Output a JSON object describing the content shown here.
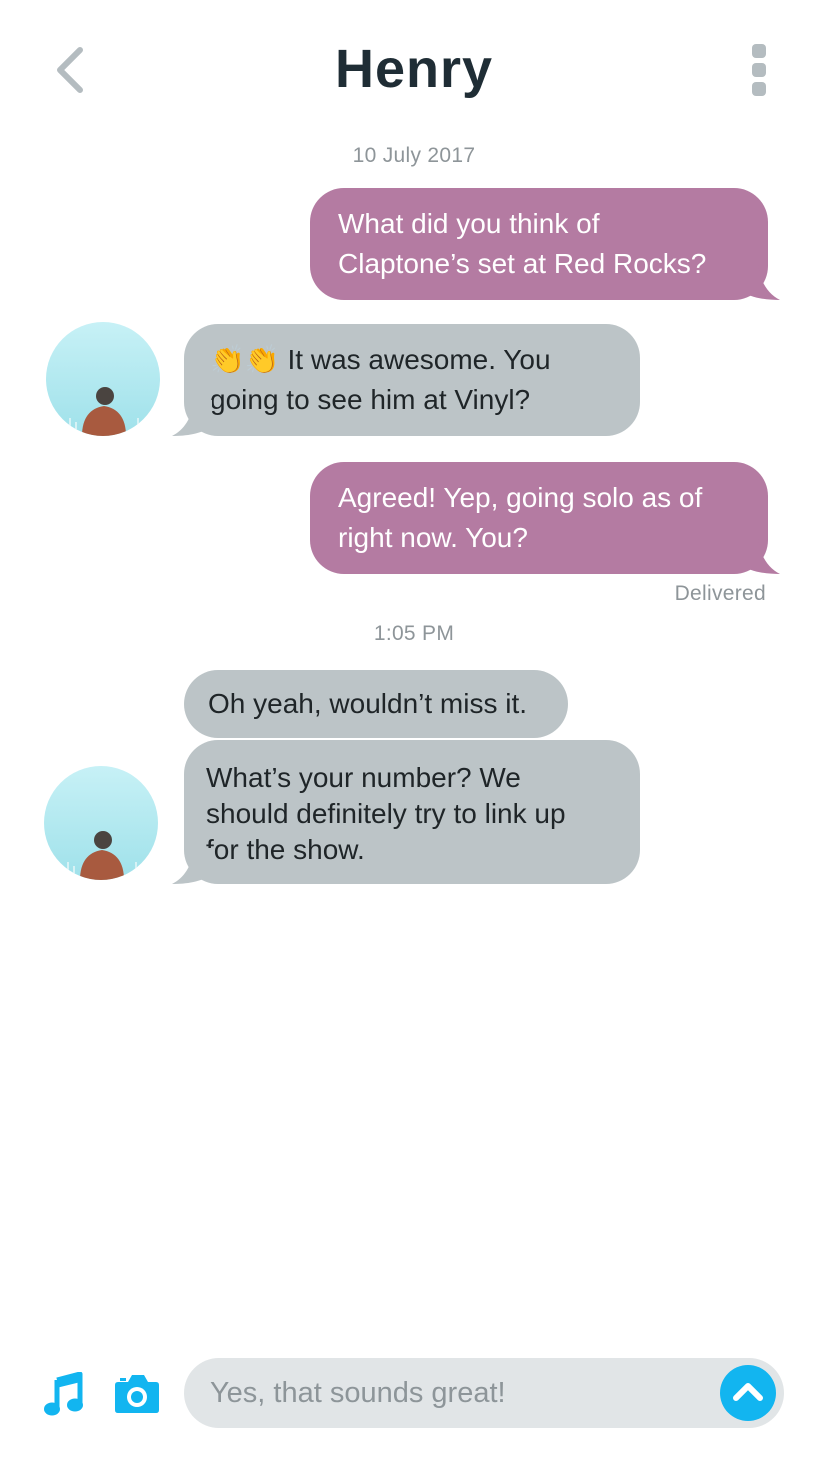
{
  "header": {
    "title": "Henry",
    "back_icon": "chevron-left-icon",
    "more_icon": "vertical-ellipsis-icon"
  },
  "colors": {
    "outgoing_bubble": "#b47ba2",
    "incoming_bubble": "#bcc4c7",
    "accent": "#12b5f0"
  },
  "conversation": {
    "date_stamp": "10 July 2017",
    "time_stamp": "1:05 PM",
    "delivered_label": "Delivered",
    "messages": [
      {
        "direction": "out",
        "lines": [
          "What did you think of",
          "Claptone’s set at Red Rocks?"
        ]
      },
      {
        "direction": "in",
        "emoji": "👏👏",
        "lines": [
          " It was awesome. You",
          "going to see him at Vinyl?"
        ]
      },
      {
        "direction": "out",
        "lines": [
          "Agreed! Yep, going solo as of",
          "right now. You?"
        ]
      },
      {
        "direction": "in",
        "lines": [
          "Oh yeah, wouldn’t miss it."
        ]
      },
      {
        "direction": "in",
        "lines": [
          "What’s your number? We",
          "should definitely try to link up",
          "for the show."
        ]
      }
    ]
  },
  "composer": {
    "value": "Yes, that sounds great!",
    "music_icon": "music-note-icon",
    "camera_icon": "camera-icon",
    "send_icon": "send-arrow-up-icon"
  }
}
